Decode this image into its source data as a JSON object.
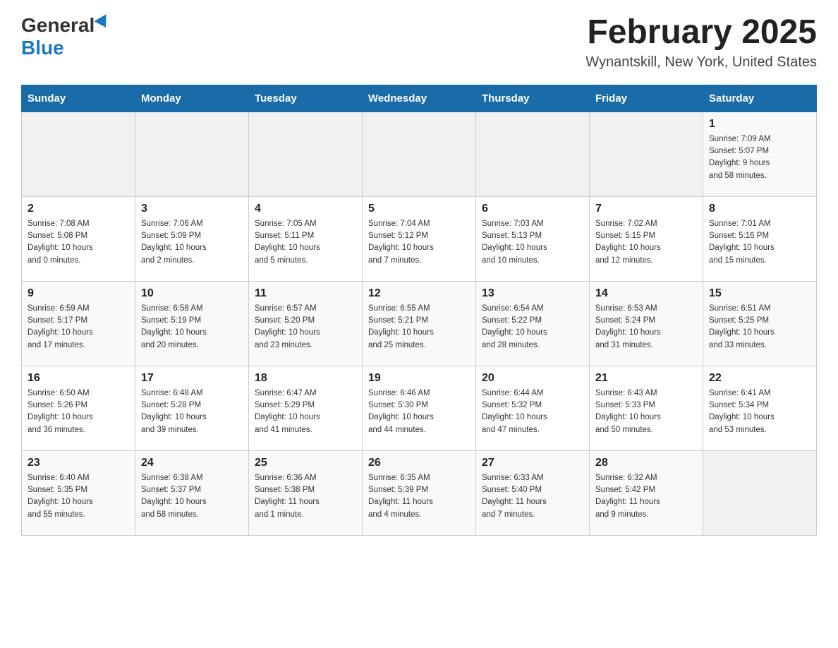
{
  "logo": {
    "general_text": "General",
    "blue_text": "Blue"
  },
  "header": {
    "title": "February 2025",
    "subtitle": "Wynantskill, New York, United States"
  },
  "weekdays": [
    "Sunday",
    "Monday",
    "Tuesday",
    "Wednesday",
    "Thursday",
    "Friday",
    "Saturday"
  ],
  "weeks": [
    [
      {
        "day": "",
        "info": ""
      },
      {
        "day": "",
        "info": ""
      },
      {
        "day": "",
        "info": ""
      },
      {
        "day": "",
        "info": ""
      },
      {
        "day": "",
        "info": ""
      },
      {
        "day": "",
        "info": ""
      },
      {
        "day": "1",
        "info": "Sunrise: 7:09 AM\nSunset: 5:07 PM\nDaylight: 9 hours\nand 58 minutes."
      }
    ],
    [
      {
        "day": "2",
        "info": "Sunrise: 7:08 AM\nSunset: 5:08 PM\nDaylight: 10 hours\nand 0 minutes."
      },
      {
        "day": "3",
        "info": "Sunrise: 7:06 AM\nSunset: 5:09 PM\nDaylight: 10 hours\nand 2 minutes."
      },
      {
        "day": "4",
        "info": "Sunrise: 7:05 AM\nSunset: 5:11 PM\nDaylight: 10 hours\nand 5 minutes."
      },
      {
        "day": "5",
        "info": "Sunrise: 7:04 AM\nSunset: 5:12 PM\nDaylight: 10 hours\nand 7 minutes."
      },
      {
        "day": "6",
        "info": "Sunrise: 7:03 AM\nSunset: 5:13 PM\nDaylight: 10 hours\nand 10 minutes."
      },
      {
        "day": "7",
        "info": "Sunrise: 7:02 AM\nSunset: 5:15 PM\nDaylight: 10 hours\nand 12 minutes."
      },
      {
        "day": "8",
        "info": "Sunrise: 7:01 AM\nSunset: 5:16 PM\nDaylight: 10 hours\nand 15 minutes."
      }
    ],
    [
      {
        "day": "9",
        "info": "Sunrise: 6:59 AM\nSunset: 5:17 PM\nDaylight: 10 hours\nand 17 minutes."
      },
      {
        "day": "10",
        "info": "Sunrise: 6:58 AM\nSunset: 5:19 PM\nDaylight: 10 hours\nand 20 minutes."
      },
      {
        "day": "11",
        "info": "Sunrise: 6:57 AM\nSunset: 5:20 PM\nDaylight: 10 hours\nand 23 minutes."
      },
      {
        "day": "12",
        "info": "Sunrise: 6:55 AM\nSunset: 5:21 PM\nDaylight: 10 hours\nand 25 minutes."
      },
      {
        "day": "13",
        "info": "Sunrise: 6:54 AM\nSunset: 5:22 PM\nDaylight: 10 hours\nand 28 minutes."
      },
      {
        "day": "14",
        "info": "Sunrise: 6:53 AM\nSunset: 5:24 PM\nDaylight: 10 hours\nand 31 minutes."
      },
      {
        "day": "15",
        "info": "Sunrise: 6:51 AM\nSunset: 5:25 PM\nDaylight: 10 hours\nand 33 minutes."
      }
    ],
    [
      {
        "day": "16",
        "info": "Sunrise: 6:50 AM\nSunset: 5:26 PM\nDaylight: 10 hours\nand 36 minutes."
      },
      {
        "day": "17",
        "info": "Sunrise: 6:48 AM\nSunset: 5:28 PM\nDaylight: 10 hours\nand 39 minutes."
      },
      {
        "day": "18",
        "info": "Sunrise: 6:47 AM\nSunset: 5:29 PM\nDaylight: 10 hours\nand 41 minutes."
      },
      {
        "day": "19",
        "info": "Sunrise: 6:46 AM\nSunset: 5:30 PM\nDaylight: 10 hours\nand 44 minutes."
      },
      {
        "day": "20",
        "info": "Sunrise: 6:44 AM\nSunset: 5:32 PM\nDaylight: 10 hours\nand 47 minutes."
      },
      {
        "day": "21",
        "info": "Sunrise: 6:43 AM\nSunset: 5:33 PM\nDaylight: 10 hours\nand 50 minutes."
      },
      {
        "day": "22",
        "info": "Sunrise: 6:41 AM\nSunset: 5:34 PM\nDaylight: 10 hours\nand 53 minutes."
      }
    ],
    [
      {
        "day": "23",
        "info": "Sunrise: 6:40 AM\nSunset: 5:35 PM\nDaylight: 10 hours\nand 55 minutes."
      },
      {
        "day": "24",
        "info": "Sunrise: 6:38 AM\nSunset: 5:37 PM\nDaylight: 10 hours\nand 58 minutes."
      },
      {
        "day": "25",
        "info": "Sunrise: 6:36 AM\nSunset: 5:38 PM\nDaylight: 11 hours\nand 1 minute."
      },
      {
        "day": "26",
        "info": "Sunrise: 6:35 AM\nSunset: 5:39 PM\nDaylight: 11 hours\nand 4 minutes."
      },
      {
        "day": "27",
        "info": "Sunrise: 6:33 AM\nSunset: 5:40 PM\nDaylight: 11 hours\nand 7 minutes."
      },
      {
        "day": "28",
        "info": "Sunrise: 6:32 AM\nSunset: 5:42 PM\nDaylight: 11 hours\nand 9 minutes."
      },
      {
        "day": "",
        "info": ""
      }
    ]
  ],
  "colors": {
    "header_bg": "#1a6ca8",
    "header_text": "#ffffff",
    "logo_blue": "#1a7abf",
    "row_odd": "#f9f9f9",
    "row_even": "#ffffff",
    "empty_cell": "#f0f0f0"
  }
}
